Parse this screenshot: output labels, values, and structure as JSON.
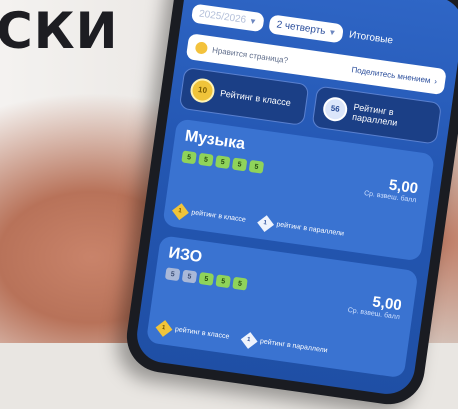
{
  "headline": "СКИ",
  "topbar": {
    "year_value": "2025/2026",
    "quarter_value": "2 четверть",
    "total_link": "Итоговые"
  },
  "like_bar": {
    "question": "Нравится страница?",
    "share": "Поделитесь мнением"
  },
  "ratings": [
    {
      "badge": "10",
      "label": "Рейтинг в классе"
    },
    {
      "badge": "56",
      "label": "Рейтинг в параллели"
    }
  ],
  "subjects": [
    {
      "name": "Музыка",
      "grades": [
        "5",
        "5",
        "5",
        "5",
        "5"
      ],
      "grade_style": [
        "green",
        "green",
        "green",
        "green",
        "green"
      ],
      "score": "5,00",
      "score_label": "Ср. взвеш. балл",
      "class_badge": "1",
      "class_label": "рейтинг в классе",
      "par_badge": "1",
      "par_label": "рейтинг в параллели"
    },
    {
      "name": "ИЗО",
      "grades": [
        "5",
        "5",
        "5",
        "5",
        "5"
      ],
      "grade_style": [
        "gray",
        "gray",
        "green",
        "green",
        "green"
      ],
      "score": "5,00",
      "score_label": "Ср. взвеш. балл",
      "class_badge": "1",
      "class_label": "рейтинг в классе",
      "par_badge": "1",
      "par_label": "рейтинг в параллели"
    }
  ],
  "colors": {
    "screen_blue": "#2457b3",
    "card_blue": "#3a73d1",
    "grade_green": "#8fd35a",
    "gold": "#f0c43a"
  }
}
